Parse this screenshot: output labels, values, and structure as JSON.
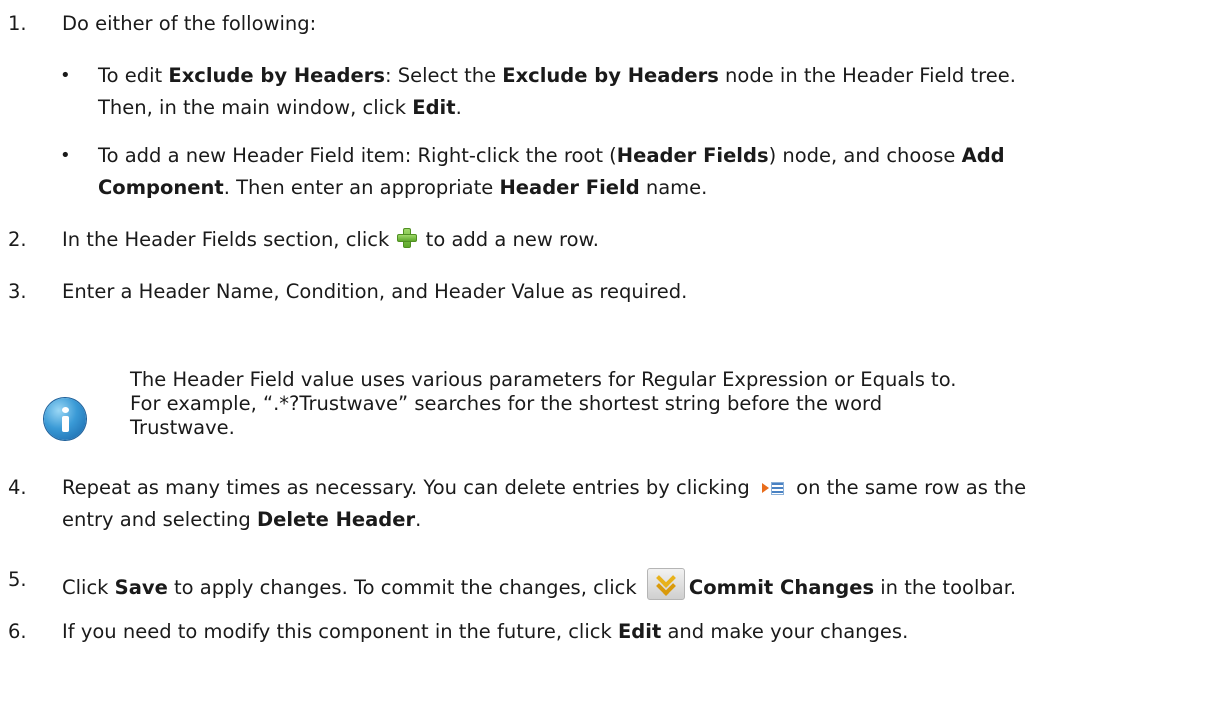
{
  "steps": {
    "s1": {
      "num": "1.",
      "text": "Do either of the following:",
      "bullets": {
        "b1": {
          "p1": "To edit ",
          "b1": "Exclude by Headers",
          "p2": ": Select the ",
          "b2": "Exclude by Headers",
          "p3": " node in the Header Field tree.",
          "p4": "Then, in the main window, click ",
          "b3": "Edit",
          "p5": "."
        },
        "b2": {
          "p1": "To add a new Header Field item: Right-click the root (",
          "b1": "Header Fields",
          "p2": ") node, and choose ",
          "b2": "Add",
          "b3": "Component",
          "p3": ". Then enter an appropriate ",
          "b4": "Header Field",
          "p4": " name."
        }
      }
    },
    "s2": {
      "num": "2.",
      "p1": "In the Header Fields section, click ",
      "p2": " to add a new row."
    },
    "s3": {
      "num": "3.",
      "text": "Enter a Header Name, Condition, and Header Value as required."
    },
    "note": {
      "l1": "The Header Field value uses various parameters for Regular Expression or Equals to.",
      "l2": "For example, “.*?Trustwave” searches for the shortest string before the word",
      "l3": "Trustwave."
    },
    "s4": {
      "num": "4.",
      "p1": "Repeat as many times as necessary. You can delete entries by clicking ",
      "p2": " on the same row as the",
      "p3": "entry and selecting ",
      "b1": "Delete Header",
      "p4": "."
    },
    "s5": {
      "num": "5.",
      "p1": "Click ",
      "b1": "Save",
      "p2": " to apply changes. To commit the changes, click ",
      "b2": "Commit Changes",
      "p3": " in the toolbar."
    },
    "s6": {
      "num": "6.",
      "p1": "If you need to modify this component in the future, click ",
      "b1": "Edit",
      "p2": " and make your changes."
    }
  },
  "icons": {
    "bullet": "•",
    "add": "plus-icon",
    "row_menu": "row-menu-icon",
    "commit": "commit-changes-icon",
    "note": "info-icon"
  }
}
